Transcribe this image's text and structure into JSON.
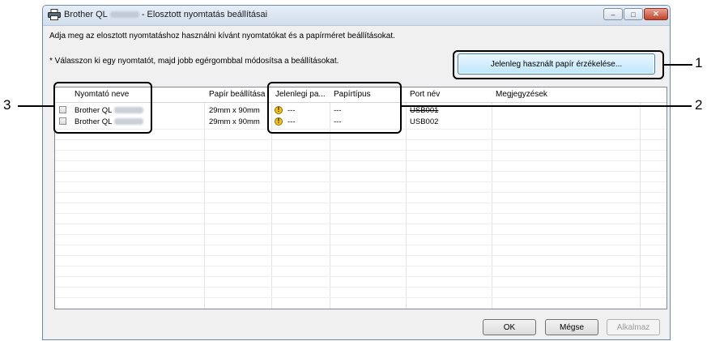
{
  "window": {
    "title_prefix": "Brother QL",
    "title_suffix": "- Elosztott nyomtatás beállításai",
    "min_glyph": "–",
    "max_glyph": "□",
    "close_glyph": "✕"
  },
  "instructions": {
    "description": "Adja meg az elosztott nyomtatáshoz használni kívánt nyomtatókat és a papírméret beállításokat.",
    "hint": "* Válasszon ki egy nyomtatót, majd jobb egérgombbal módosítsa a beállításokat."
  },
  "detect_button": {
    "label": "Jelenleg használt papír érzékelése..."
  },
  "table": {
    "headers": {
      "printer_name": "Nyomtató neve",
      "paper_setting": "Papír beállítása",
      "current_paper": "Jelenlegi pa...",
      "paper_type": "Papírtípus",
      "port_name": "Port név",
      "notes": "Megjegyzések"
    },
    "rows": [
      {
        "checked": false,
        "printer_name": "Brother QL",
        "paper_setting": "29mm x 90mm",
        "status_icon": "warning-icon",
        "current_paper": "---",
        "paper_type": "---",
        "port_name": "USB001",
        "notes": ""
      },
      {
        "checked": false,
        "printer_name": "Brother QL",
        "paper_setting": "29mm x 90mm",
        "status_icon": "warning-icon",
        "current_paper": "---",
        "paper_type": "---",
        "port_name": "USB002",
        "notes": ""
      }
    ]
  },
  "footer": {
    "ok_label": "OK",
    "cancel_label": "Mégse",
    "apply_label": "Alkalmaz"
  },
  "callouts": {
    "label_1": "1",
    "label_2": "2",
    "label_3": "3"
  },
  "colors": {
    "accent": "#3c7fb1",
    "warning": "#f2c30f",
    "close_button": "#c0442b"
  }
}
